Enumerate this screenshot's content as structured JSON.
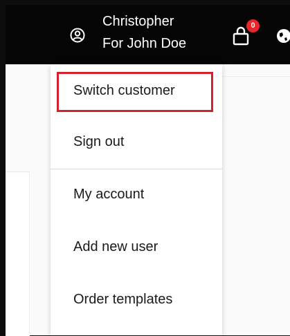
{
  "header": {
    "user_name": "Christopher",
    "user_sub": "For John Doe",
    "user_icon": "user-circle-icon",
    "cart_icon": "shopping-bag-icon",
    "cart_count": "0",
    "globe_icon": "globe-icon"
  },
  "menu": {
    "items": [
      {
        "label": "Switch customer"
      },
      {
        "label": "Sign out"
      },
      {
        "label": "My account"
      },
      {
        "label": "Add new user"
      },
      {
        "label": "Order templates"
      }
    ]
  },
  "colors": {
    "header_bg": "#050505",
    "badge": "#e8262b",
    "highlight": "#d3202a"
  }
}
